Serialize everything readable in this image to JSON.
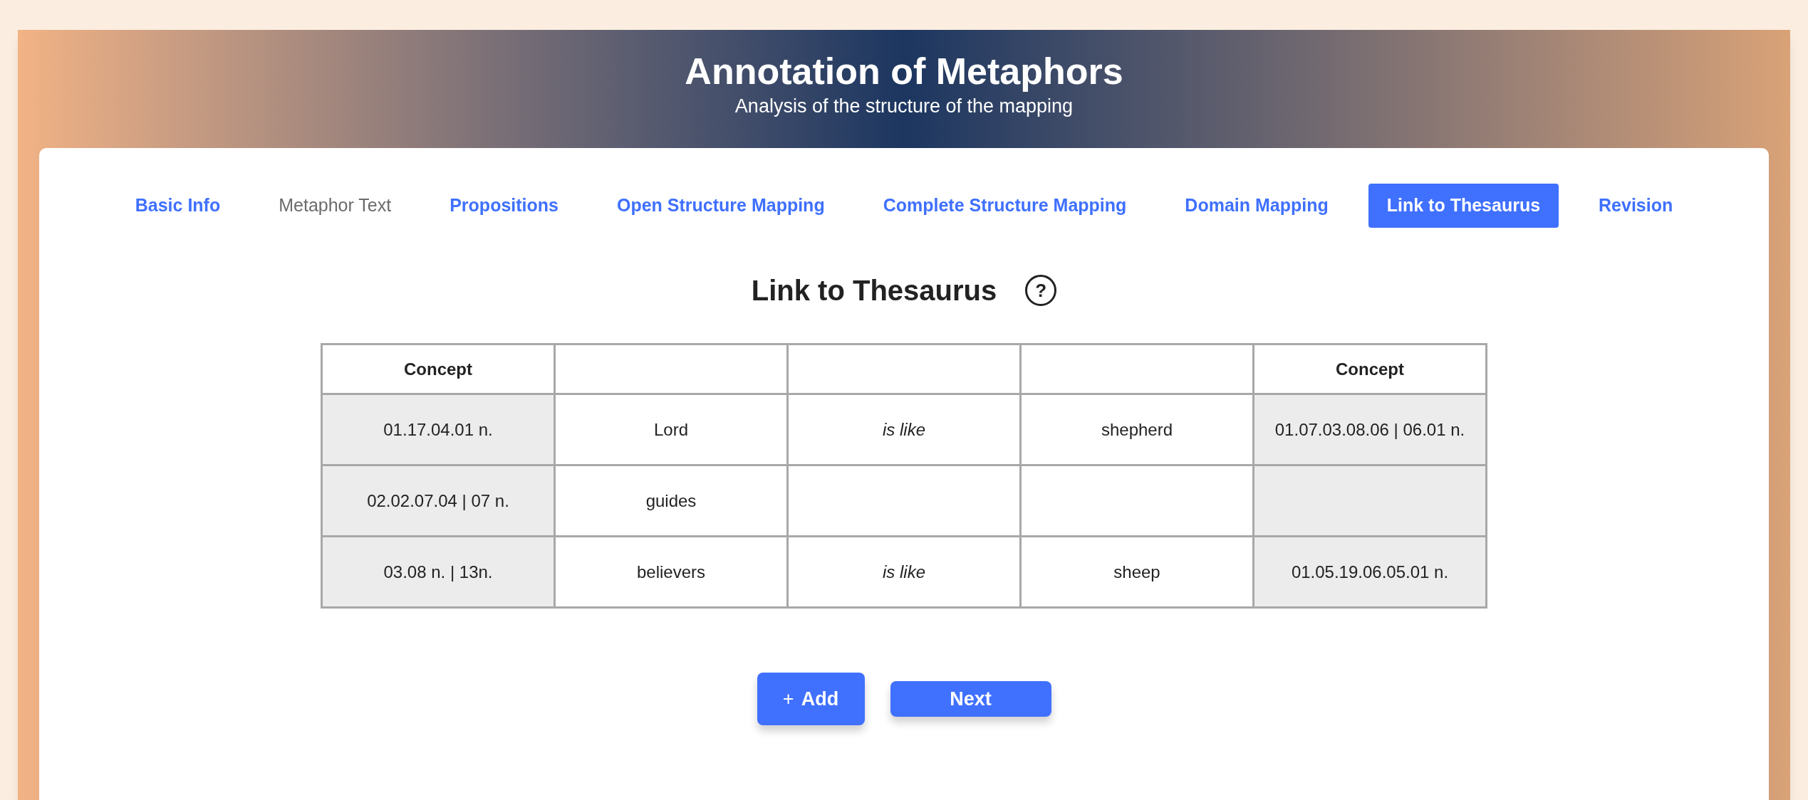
{
  "header": {
    "title": "Annotation of Metaphors",
    "subtitle": "Analysis of the structure of the mapping"
  },
  "tabs": [
    {
      "label": "Basic Info",
      "selected": false,
      "disabled": false
    },
    {
      "label": "Metaphor Text",
      "selected": false,
      "disabled": true
    },
    {
      "label": "Propositions",
      "selected": false,
      "disabled": false
    },
    {
      "label": "Open Structure Mapping",
      "selected": false,
      "disabled": false
    },
    {
      "label": "Complete Structure Mapping",
      "selected": false,
      "disabled": false
    },
    {
      "label": "Domain Mapping",
      "selected": false,
      "disabled": false
    },
    {
      "label": "Link to Thesaurus",
      "selected": true,
      "disabled": false
    },
    {
      "label": "Revision",
      "selected": false,
      "disabled": false
    }
  ],
  "section": {
    "title": "Link to Thesaurus",
    "help_icon": "?"
  },
  "table": {
    "columns": [
      "Concept",
      "",
      "",
      "",
      "Concept"
    ],
    "rows": [
      {
        "cells": [
          {
            "text": "01.17.04.01 n.",
            "kind": "code"
          },
          {
            "text": "Lord",
            "kind": "word"
          },
          {
            "text": "is like",
            "kind": "relation"
          },
          {
            "text": "shepherd",
            "kind": "word"
          },
          {
            "text": "01.07.03.08.06 | 06.01 n.",
            "kind": "code"
          }
        ]
      },
      {
        "cells": [
          {
            "text": "02.02.07.04 | 07 n.",
            "kind": "code"
          },
          {
            "text": "guides",
            "kind": "word"
          },
          {
            "text": "",
            "kind": "relation"
          },
          {
            "text": "",
            "kind": "word"
          },
          {
            "text": "",
            "kind": "code"
          }
        ]
      },
      {
        "cells": [
          {
            "text": "03.08 n. | 13n.",
            "kind": "code"
          },
          {
            "text": "believers",
            "kind": "word"
          },
          {
            "text": "is like",
            "kind": "relation"
          },
          {
            "text": "sheep",
            "kind": "word"
          },
          {
            "text": "01.05.19.06.05.01 n.",
            "kind": "code"
          }
        ]
      }
    ]
  },
  "buttons": {
    "add": {
      "icon": "+",
      "label": "Add"
    },
    "next": {
      "label": "Next"
    }
  }
}
